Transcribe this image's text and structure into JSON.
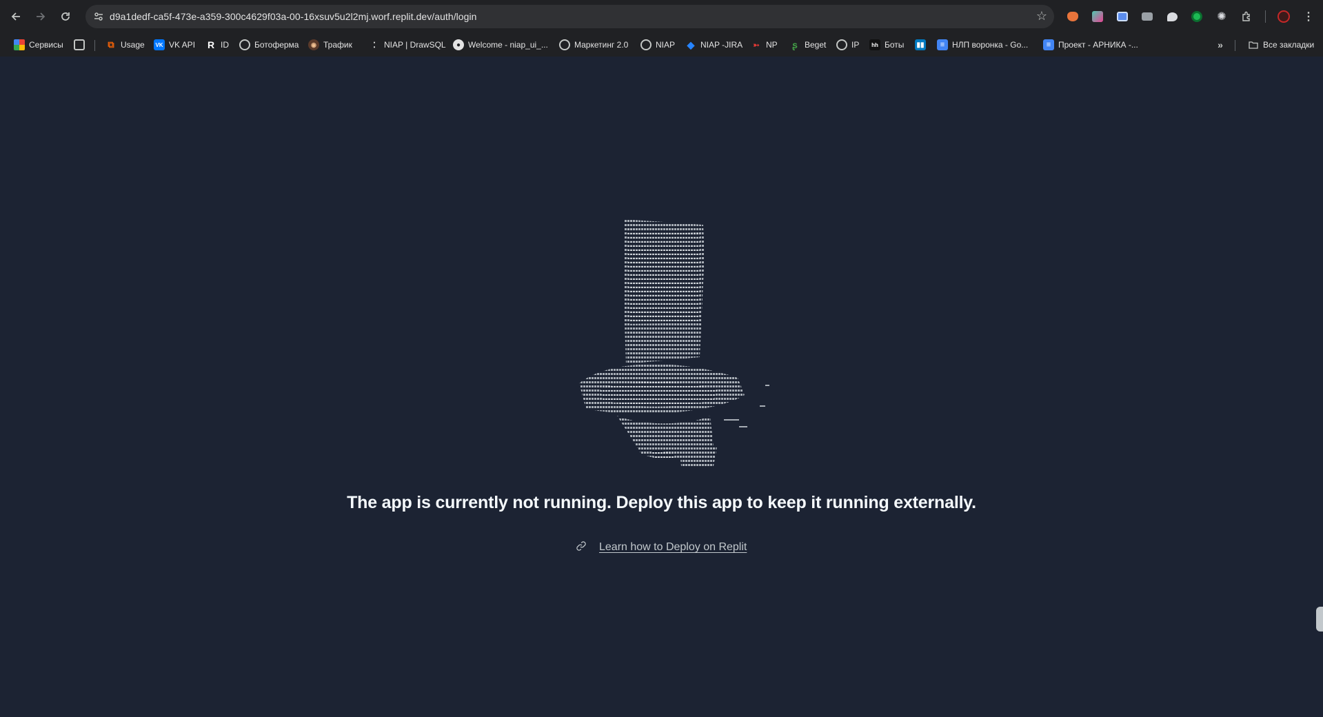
{
  "browser": {
    "url": "d9a1dedf-ca5f-473e-a359-300c4629f03a-00-16xsuv5u2l2mj.worf.replit.dev/auth/login",
    "bookmarks": [
      {
        "label": "Сервисы",
        "icon": "apps-grid-icon"
      },
      {
        "label": "",
        "icon": "tab-groups-icon"
      },
      {
        "label": "Usage",
        "icon": "replit-icon"
      },
      {
        "label": "VK API",
        "icon": "vk-icon"
      },
      {
        "label": "ID",
        "icon": "r-logo-icon"
      },
      {
        "label": "Ботоферма",
        "icon": "globe-icon"
      },
      {
        "label": "Трафик",
        "icon": "traffic-icon"
      },
      {
        "label": "NIAP | DrawSQL",
        "icon": "drawsql-icon"
      },
      {
        "label": "Welcome - niap_ui_...",
        "icon": "github-icon"
      },
      {
        "label": "Маркетинг 2.0",
        "icon": "globe-icon"
      },
      {
        "label": "NIAP",
        "icon": "globe-icon"
      },
      {
        "label": "NIAP -JIRA",
        "icon": "jira-icon"
      },
      {
        "label": "NP",
        "icon": "np-icon"
      },
      {
        "label": "Beget",
        "icon": "beget-icon"
      },
      {
        "label": "IP",
        "icon": "globe-icon"
      },
      {
        "label": "Боты",
        "icon": "bots-icon"
      },
      {
        "label": "",
        "icon": "trello-icon"
      },
      {
        "label": "НЛП воронка - Go...",
        "icon": "docs-icon"
      },
      {
        "label": "Проект - АРНИКА -...",
        "icon": "docs-icon"
      }
    ],
    "all_bookmarks_label": "Все закладки",
    "more_icon": "double-chevron-icon"
  },
  "page": {
    "message": "The app is currently not running. Deploy this app to keep it running externally.",
    "link_text": "Learn how to Deploy on Replit",
    "link_icon": "link-icon"
  },
  "colors": {
    "background": "#1c2333",
    "chrome": "#202124",
    "text": "#f5f9fc",
    "link": "#c2c8cc"
  }
}
